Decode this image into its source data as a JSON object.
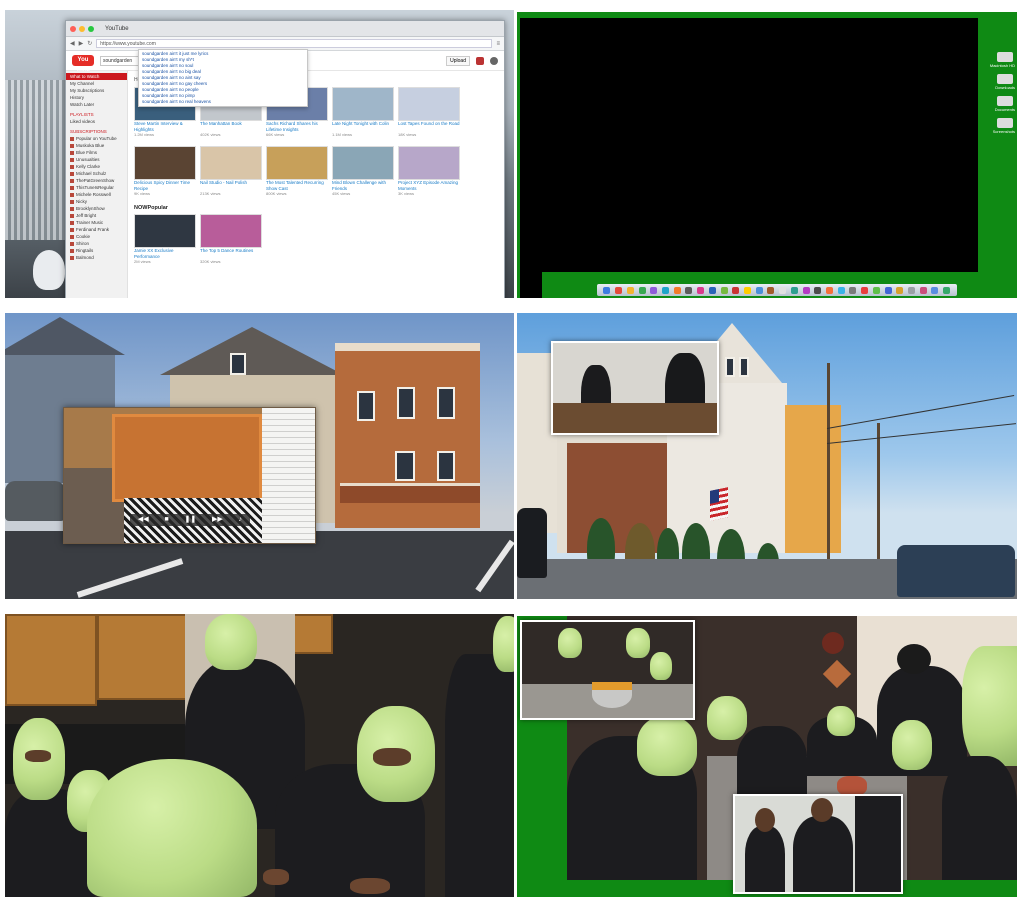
{
  "youtube": {
    "tab_title": "YouTube",
    "url": "https://www.youtube.com",
    "logo": "You Tube",
    "search_query": "soundgarden",
    "upload_label": "Upload",
    "suggestions": [
      "soundgarden ain't it just me lyrics",
      "soundgarden ain't my sh*t",
      "soundgarden ain't no soul",
      "soundgarden ain't no big deal",
      "soundgarden ain't no aint say",
      "soundgarden ain't no gay cheers",
      "soundgarden ain't no people",
      "soundgarden ain't no pimp",
      "soundgarden ain't no real heavens"
    ],
    "tabs": [
      "Home",
      "Trending",
      "Subscriptions",
      "Music"
    ],
    "sidebar": {
      "items": [
        "What to Watch",
        "My Channel",
        "My Subscriptions",
        "History",
        "Watch Later"
      ],
      "playlists_heading": "PLAYLISTS",
      "playlist_items": [
        "Liked videos"
      ],
      "subs_heading": "SUBSCRIPTIONS",
      "subscriptions": [
        "Popular on YouTube",
        "Muskoka Blue",
        "Blue Films",
        "Unusualties",
        "Kelly Clarke",
        "Michael Schulz",
        "ThePatGreenShow",
        "ThisTuneIsRegular",
        "Michele Rosswell",
        "Nicky",
        "BrooklynShow",
        "Jeff Bright",
        "Trainer Music",
        "Ferdinand Frank",
        "Cookie",
        "Shiron",
        "Ringtails",
        "Balmond"
      ]
    },
    "videos_row1": [
      {
        "title": "Steve Martin Interview & Highlights",
        "meta": "1.2M views"
      },
      {
        "title": "The Manhattan Book",
        "meta": "402K views"
      },
      {
        "title": "Sachs Richard Shares his Lifetime Insights",
        "meta": "66K views"
      },
      {
        "title": "Late Night Tonight with Colin",
        "meta": "1.1M views"
      },
      {
        "title": "Lost Tapes Found on the Road",
        "meta": "18K views"
      }
    ],
    "videos_row2": [
      {
        "title": "Delicious Spicy Dinner Time Recipe",
        "meta": "9K views"
      },
      {
        "title": "Nail Studio - Nail Polish",
        "meta": "213K views"
      },
      {
        "title": "The Most Talented Recurring Show Cast",
        "meta": "800K views"
      },
      {
        "title": "Mind Blown Challenge with Friends",
        "meta": "45K views"
      },
      {
        "title": "Project XYZ Episode Amazing Moments",
        "meta": "3K views"
      }
    ],
    "section_title": "NOWPopular",
    "videos_row3": [
      {
        "title": "Jamie XX Exclusive Performance",
        "meta": "2M views"
      },
      {
        "title": "The Top 5 Dance Routines",
        "meta": "320K views"
      }
    ]
  },
  "desktop": {
    "icons": [
      "Macintosh HD",
      "Downloads",
      "Documents",
      "Screenshots"
    ]
  },
  "player": {
    "controls": [
      "◀◀",
      "■",
      "❚❚",
      "▶▶",
      "♪"
    ]
  },
  "colors": {
    "green_screen": "#0f8a14",
    "youtube_red": "#e52d27",
    "mask_green": "#c9e89a"
  }
}
